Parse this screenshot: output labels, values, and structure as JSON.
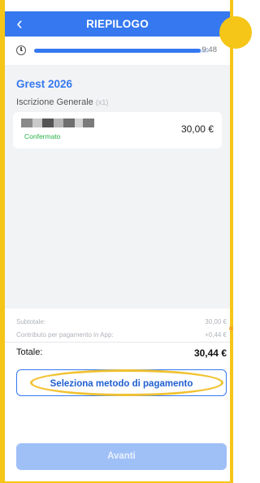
{
  "header": {
    "title": "RIEPILOGO",
    "back_icon": "chevron-left-icon"
  },
  "timer": {
    "time_text": "9:48",
    "progress": 0.95,
    "clock_icon": "clock-icon"
  },
  "order": {
    "event_title": "Grest 2026",
    "product_label": "Iscrizione Generale",
    "product_qty": "(x1)",
    "item": {
      "name_redacted": true,
      "status": "Confermato",
      "price": "30,00 €"
    }
  },
  "summary": {
    "subtotal_label": "Subtotale:",
    "subtotal_value": "30,00 €",
    "fee_label": "Contributo per pagamento in App:",
    "fee_value": "+0,44 €",
    "total_label": "Totale:",
    "total_value": "30,44 €"
  },
  "actions": {
    "select_payment_label": "Seleziona metodo di pagamento",
    "next_label": "Avanti"
  },
  "colors": {
    "primary": "#3578f0",
    "highlight": "#f5c518",
    "success": "#29b34a"
  }
}
